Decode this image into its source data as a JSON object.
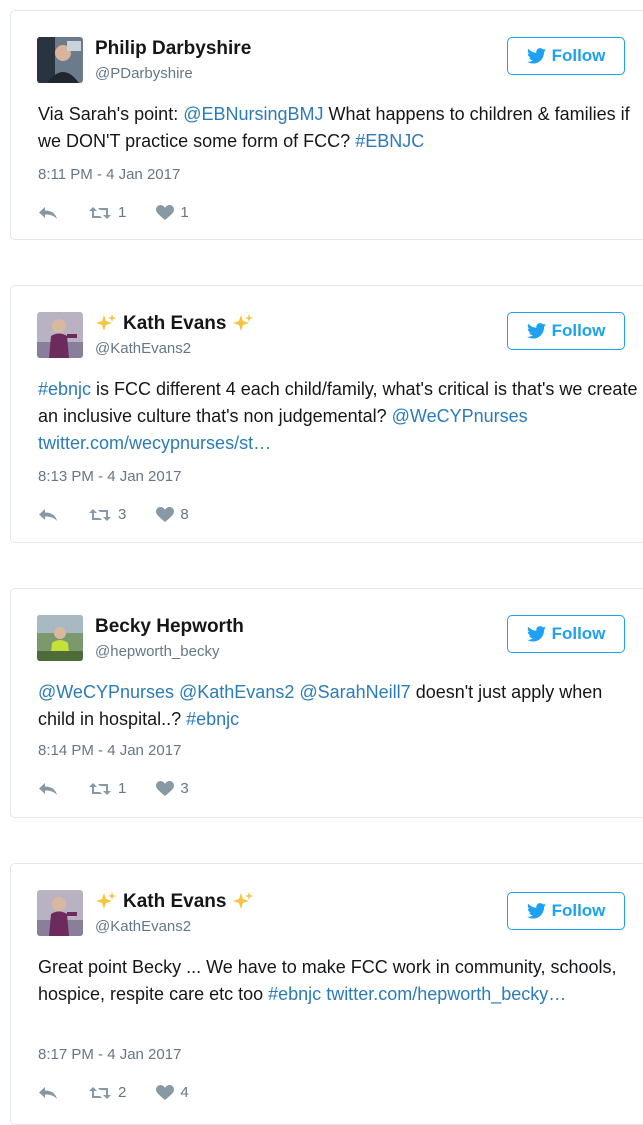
{
  "colors": {
    "accent": "#1da1f2",
    "link": "#2b7bb9",
    "muted": "#657786",
    "border": "#e1e8ed"
  },
  "follow_label": "Follow",
  "tweets": [
    {
      "name": "Philip Darbyshire",
      "handle": "@PDarbyshire",
      "text": [
        {
          "t": "Via Sarah's point: ",
          "link": false
        },
        {
          "t": "@EBNursingBMJ",
          "link": true
        },
        {
          "t": " What happens to children & families if we DON'T practice some form of FCC? ",
          "link": false
        },
        {
          "t": "#EBNJC",
          "link": true
        }
      ],
      "time": "8:11 PM - 4 Jan 2017",
      "retweets": "1",
      "likes": "1"
    },
    {
      "name": "Kath Evans",
      "handle": "@KathEvans2",
      "text": [
        {
          "t": "#ebnjc",
          "link": true
        },
        {
          "t": " is FCC different 4 each child/family, what's critical is that's we create an inclusive culture that's non judgemental? ",
          "link": false
        },
        {
          "t": "@WeCYPnurses",
          "link": true
        },
        {
          "t": " ",
          "link": false
        },
        {
          "t": "twitter.com/wecypnurses/st…",
          "link": true
        }
      ],
      "time": "8:13 PM - 4 Jan 2017",
      "retweets": "3",
      "likes": "8"
    },
    {
      "name": "Becky Hepworth",
      "handle": "@hepworth_becky",
      "text": [
        {
          "t": "@WeCYPnurses",
          "link": true
        },
        {
          "t": " ",
          "link": false
        },
        {
          "t": "@KathEvans2",
          "link": true
        },
        {
          "t": " ",
          "link": false
        },
        {
          "t": "@SarahNeill7",
          "link": true
        },
        {
          "t": " doesn't just apply when child in hospital..? ",
          "link": false
        },
        {
          "t": "#ebnjc",
          "link": true
        }
      ],
      "time": "8:14 PM - 4 Jan 2017",
      "retweets": "1",
      "likes": "3"
    },
    {
      "name": "Kath Evans",
      "handle": "@KathEvans2",
      "text": [
        {
          "t": "Great point Becky ... We have to make FCC work in community, schools, hospice, respite care etc too ",
          "link": false
        },
        {
          "t": "#ebnjc",
          "link": true
        },
        {
          "t": " ",
          "link": false
        },
        {
          "t": "twitter.com/hepworth_becky…",
          "link": true
        }
      ],
      "time": "8:17 PM - 4 Jan 2017",
      "retweets": "2",
      "likes": "4"
    }
  ]
}
